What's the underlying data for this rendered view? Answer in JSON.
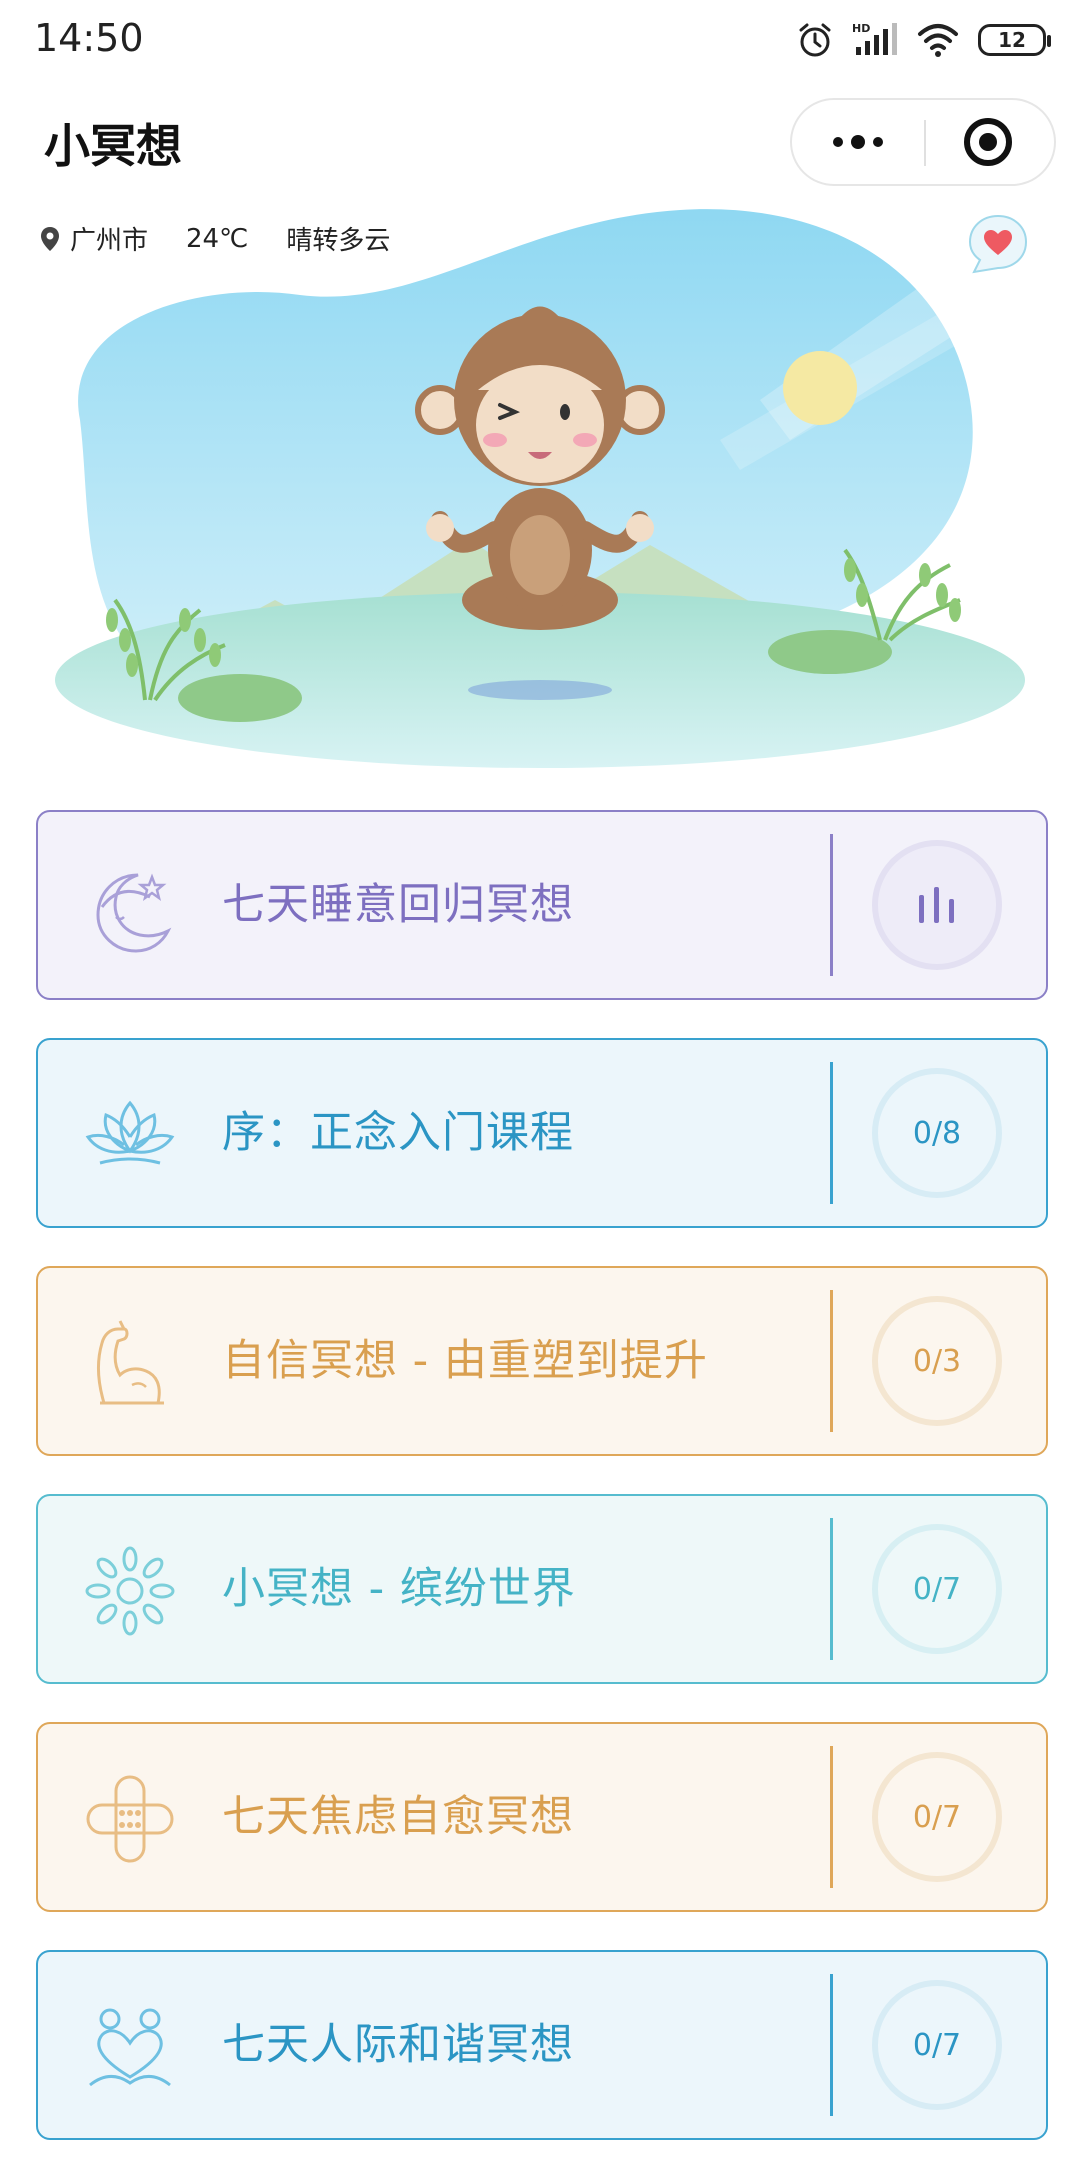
{
  "status_bar": {
    "time": "14:50",
    "network": "HD",
    "battery": "12"
  },
  "header": {
    "title": "小冥想"
  },
  "hero": {
    "city": "广州市",
    "temperature": "24℃",
    "weather": "晴转多云"
  },
  "courses": [
    {
      "title": "七天睡意回归冥想",
      "progress": "",
      "icon": "moon-icon",
      "color": "#8b80c7"
    },
    {
      "title": "序：正念入门课程",
      "progress": "0/8",
      "icon": "lotus-icon",
      "color": "#39a2cf"
    },
    {
      "title": "自信冥想 - 由重塑到提升",
      "progress": "0/3",
      "icon": "muscle-arm-icon",
      "color": "#dfa759"
    },
    {
      "title": "小冥想 - 缤纷世界",
      "progress": "0/7",
      "icon": "flower-burst-icon",
      "color": "#56bccf"
    },
    {
      "title": "七天焦虑自愈冥想",
      "progress": "0/7",
      "icon": "bandage-icon",
      "color": "#dfa759"
    },
    {
      "title": "七天人际和谐冥想",
      "progress": "0/7",
      "icon": "people-heart-icon",
      "color": "#39a2cf"
    }
  ]
}
